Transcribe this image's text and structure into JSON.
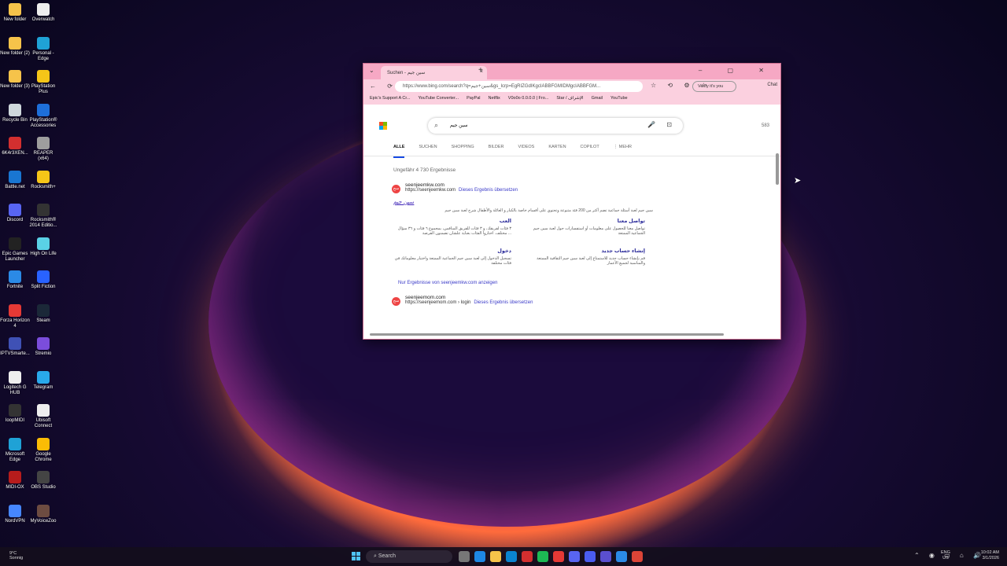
{
  "desktop": {
    "icons": [
      {
        "label": "New folder",
        "color": "#f6c34a"
      },
      {
        "label": "Overwatch",
        "color": "#eeeeee"
      },
      {
        "label": "New folder (2)",
        "color": "#f6c34a"
      },
      {
        "label": "Personal - Edge",
        "color": "#1fa2d6"
      },
      {
        "label": "New folder (3)",
        "color": "#f6c34a"
      },
      {
        "label": "PlayStation Plus",
        "color": "#f5c518"
      },
      {
        "label": "Recycle Bin",
        "color": "#cfd8dc"
      },
      {
        "label": "PlayStation® Accessories",
        "color": "#1e6fd9"
      },
      {
        "label": "6K4r3XEN...",
        "color": "#d32f2f"
      },
      {
        "label": "REAPER (x64)",
        "color": "#9e9e9e"
      },
      {
        "label": "Battle.net",
        "color": "#1976d2"
      },
      {
        "label": "Rocksmith+",
        "color": "#f5c518"
      },
      {
        "label": "Discord",
        "color": "#5865f2"
      },
      {
        "label": "Rocksmith® 2014 Editio...",
        "color": "#333333"
      },
      {
        "label": "Epic Games Launcher",
        "color": "#222222"
      },
      {
        "label": "High On Life",
        "color": "#5ad1e6"
      },
      {
        "label": "Fortnite",
        "color": "#2b8ae6"
      },
      {
        "label": "Split Fiction",
        "color": "#2962ff"
      },
      {
        "label": "Forza Horizon 4",
        "color": "#e53935"
      },
      {
        "label": "Steam",
        "color": "#1b2838"
      },
      {
        "label": "IPTVSmarte...",
        "color": "#3f51b5"
      },
      {
        "label": "Stremio",
        "color": "#7b4ddb"
      },
      {
        "label": "Logitech G HUB",
        "color": "#eeeeee"
      },
      {
        "label": "Telegram",
        "color": "#29a9eb"
      },
      {
        "label": "loopMIDI",
        "color": "#333333"
      },
      {
        "label": "Ubisoft Connect",
        "color": "#eeeeee"
      },
      {
        "label": "Microsoft Edge",
        "color": "#1fa2d6"
      },
      {
        "label": "Google Chrome",
        "color": "#fbbc05"
      },
      {
        "label": "MIDI-OX",
        "color": "#b71c1c"
      },
      {
        "label": "OBS Studio",
        "color": "#444444"
      },
      {
        "label": "NordVPN",
        "color": "#4687ff"
      },
      {
        "label": "MyVoiceZoo",
        "color": "#6d4c41"
      }
    ]
  },
  "browser": {
    "tab_title": "Suchen - سين جيم",
    "tab_close": "×",
    "new_tab": "+",
    "tab_menu": "⌄",
    "window_controls": "–  ▢  ✕",
    "nav_icons": "← ⟳",
    "url": "https://www.bing.com/search?q=سين+جيم&gs_lcrp=EgRIZGdIKgcIABBFGMIDMgcIABBFGM...",
    "tool_icons": "☆ ⟲ ⚙ ☆",
    "verify_label": "Verify it's you",
    "chat_label": "Chat",
    "bookmarks": [
      "Epic's Support A Cr...",
      "YouTube Converter...",
      "PayPal",
      "Netflix",
      "V0o0o 0.0.0.0 | Fro...",
      "Star / الإشراف",
      "Gmail",
      "YouTube"
    ],
    "search_query": "سين جيم",
    "reward_count": "583",
    "tabs": [
      "ALLE",
      "SUCHEN",
      "SHOPPING",
      "BILDER",
      "VIDEOS",
      "KARTEN",
      "COPILOT",
      "⋮ MEHR"
    ],
    "result_count": "Ungefähr 4 730 Ergebnisse",
    "result1": {
      "site": "seenjeemkw.com",
      "url": "https://seenjeemkw.com",
      "translate": "Dieses Ergebnis übersetzen",
      "title": "سين جيم",
      "snippet": "سين جيم لعبة أسئلة جماعية تضم أكثر من 200 فئة متنوعة وتحتوي على أقسام خاصة بالكبار و العائلة والأطفال شرح لعبة سين جيم",
      "deeplinks": [
        {
          "title": "العب",
          "text": "٣ فئات لفريقك، و ٣ فئات للفريق المنافس، بمجموع ٦ فئات و ٣٦ سؤال مختلف. اختاروا الفئات بعناية علشان تضمنون الفرصة ..."
        },
        {
          "title": "تواصل معنا",
          "text": "تواصل معنا للحصول على معلومات أو استفسارات حول لعبة سين جيم الجماعية الممتعة"
        },
        {
          "title": "دخول",
          "text": "تسجيل الدخول إلى لعبة سين جيم الجماعية الممتعة واختبار معلوماتك في فئات مختلفة"
        },
        {
          "title": "إنشاء حساب جديد",
          "text": "قم بإنشاء حساب جديد للاستمتاع إلى لعبة سين جيم الثقافية الممتعة والمناسبة لجميع الأعمار"
        }
      ],
      "more": "Nur Ergebnisse von seenjeemkw.com anzeigen"
    },
    "result2": {
      "site": "seenjeemom.com",
      "url": "https://seenjeemom.com › login",
      "translate": "Dieses Ergebnis übersetzen"
    }
  },
  "taskbar": {
    "weather_temp": "9°C",
    "weather_desc": "Sonnig",
    "search_placeholder": "Search",
    "app_colors": [
      "#777777",
      "#1e88e5",
      "#f6c34a",
      "#0a84d0",
      "#d32f2f",
      "#1db954",
      "#e53935",
      "#5865f2",
      "#4a5cf0",
      "#5a4fcf",
      "#2b8ae6",
      "#db4437"
    ],
    "lang_top": "ENG",
    "lang_bottom": "US",
    "tray_icons": "⌃ ◉ ▭ ⌂ 🔊",
    "time": "10:02 AM",
    "date": "3/1/2026"
  }
}
